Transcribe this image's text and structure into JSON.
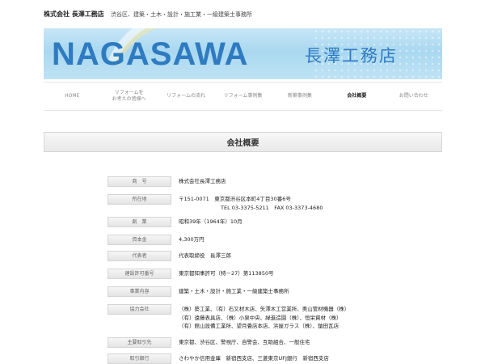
{
  "header": {
    "company_name": "株式会社 長澤工務店",
    "tagline": "渋谷区、建築・土木・設計・施工業・一級建築士事務所"
  },
  "banner": {
    "logo_en": "NAGASAWA",
    "logo_jp": "長澤工務店"
  },
  "nav": {
    "items": [
      {
        "label": "HOME"
      },
      {
        "label": "リフォームを\nお考えの皆様へ"
      },
      {
        "label": "リフォームの流れ"
      },
      {
        "label": "リフォーム事例集"
      },
      {
        "label": "新築事例集"
      },
      {
        "label": "会社概要",
        "active": true
      },
      {
        "label": "お問い合わせ"
      }
    ]
  },
  "page": {
    "section_title": "会社概要"
  },
  "profile": [
    {
      "label": "商　号",
      "lines": [
        "株式会社長澤工務店"
      ]
    },
    {
      "label": "所在地",
      "lines": [
        "〒151-0071　東京都渋谷区本町4丁目30番6号",
        "TEL 03-3375-5211　FAX 03-3373-4680"
      ]
    },
    {
      "label": "創　業",
      "lines": [
        "昭和39年（1964年）10月"
      ]
    },
    {
      "label": "資本金",
      "lines": [
        "4,300万円"
      ]
    },
    {
      "label": "代表者",
      "lines": [
        "代表取締役　長澤三郎"
      ]
    },
    {
      "label": "建設許可番号",
      "lines": [
        "東京都知事許可（特－27）第113850号"
      ]
    },
    {
      "label": "事業内容",
      "lines": [
        "建築・土木・設計・施工業・一級建築士事務所"
      ]
    },
    {
      "label": "協力会社",
      "lines": [
        "（株）葵工業、（有）石又材木店、矢澤木工営業所、奥山管材機器（株）",
        "（有）遠藤表具店、（株）小泉中央、緑進造園（株）、恒栄資材（株）",
        "（有）館山設備工業所、望月畳店本店、浜屋ガラス（株）、鎗田瓦店"
      ]
    },
    {
      "label": "主要取引先",
      "lines": [
        "東京都、渋谷区、警視庁、自警会、互助組合、一般住宅"
      ]
    },
    {
      "label": "取引銀行",
      "lines": [
        "さわやか信用金庫　新宿西支店、三菱東京UFJ銀行　新宿西支店"
      ]
    }
  ]
}
